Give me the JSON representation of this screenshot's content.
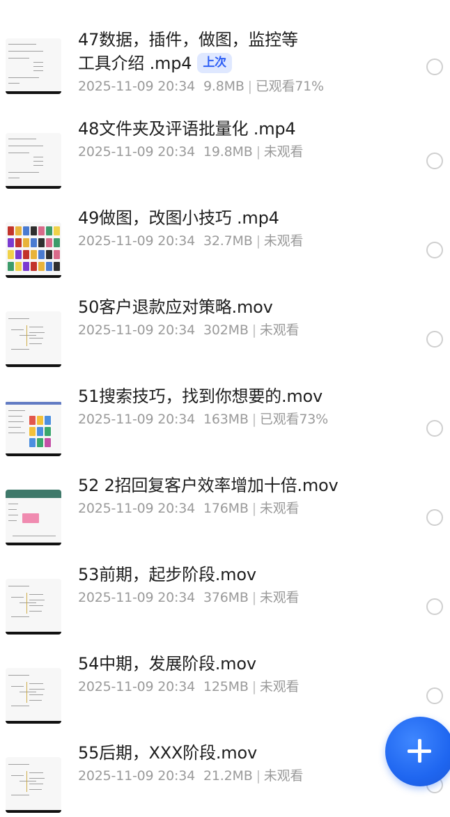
{
  "files": [
    {
      "title_lines": [
        "47数据，插件，做图，监控等",
        "工具介绍 .mp4"
      ],
      "badge": "上次",
      "date": "2025-11-09 20:34",
      "size": "9.8MB",
      "status": "已观看71%",
      "thumb_icon": "document-thumbnail-icon"
    },
    {
      "title_lines": [
        "48文件夹及评语批量化 .mp4"
      ],
      "badge": "",
      "date": "2025-11-09 20:34",
      "size": "19.8MB",
      "status": "未观看",
      "thumb_icon": "document-thumbnail-icon"
    },
    {
      "title_lines": [
        "49做图，改图小技巧 .mp4"
      ],
      "badge": "",
      "date": "2025-11-09 20:34",
      "size": "32.7MB",
      "status": "未观看",
      "thumb_icon": "poster-grid-thumbnail-icon"
    },
    {
      "title_lines": [
        "50客户退款应对策略.mov"
      ],
      "badge": "",
      "date": "2025-11-09 20:34",
      "size": "302MB",
      "status": "未观看",
      "thumb_icon": "mindmap-thumbnail-icon"
    },
    {
      "title_lines": [
        "51搜索技巧，找到你想要的.mov"
      ],
      "badge": "",
      "date": "2025-11-09 20:34",
      "size": "163MB",
      "status": "已观看73%",
      "thumb_icon": "webpage-thumbnail-icon"
    },
    {
      "title_lines": [
        "52 2招回复客户效率增加十倍.mov"
      ],
      "badge": "",
      "date": "2025-11-09 20:34",
      "size": "176MB",
      "status": "未观看",
      "thumb_icon": "chat-app-thumbnail-icon"
    },
    {
      "title_lines": [
        "53前期，起步阶段.mov"
      ],
      "badge": "",
      "date": "2025-11-09 20:34",
      "size": "376MB",
      "status": "未观看",
      "thumb_icon": "mindmap-thumbnail-icon"
    },
    {
      "title_lines": [
        "54中期，发展阶段.mov"
      ],
      "badge": "",
      "date": "2025-11-09 20:34",
      "size": "125MB",
      "status": "未观看",
      "thumb_icon": "mindmap-thumbnail-icon"
    },
    {
      "title_lines": [
        "55后期，XXX阶段.mov"
      ],
      "badge": "",
      "date": "2025-11-09 20:34",
      "size": "21.2MB",
      "status": "未观看",
      "thumb_icon": "mindmap-thumbnail-icon"
    }
  ],
  "fab": {
    "icon": "plus-icon"
  },
  "colors": {
    "accent": "#1f66f0",
    "badge_bg": "#dfe8ff",
    "badge_text": "#2e5ff5",
    "meta_text": "#9a9a9a",
    "title_text": "#1e1e1e"
  }
}
